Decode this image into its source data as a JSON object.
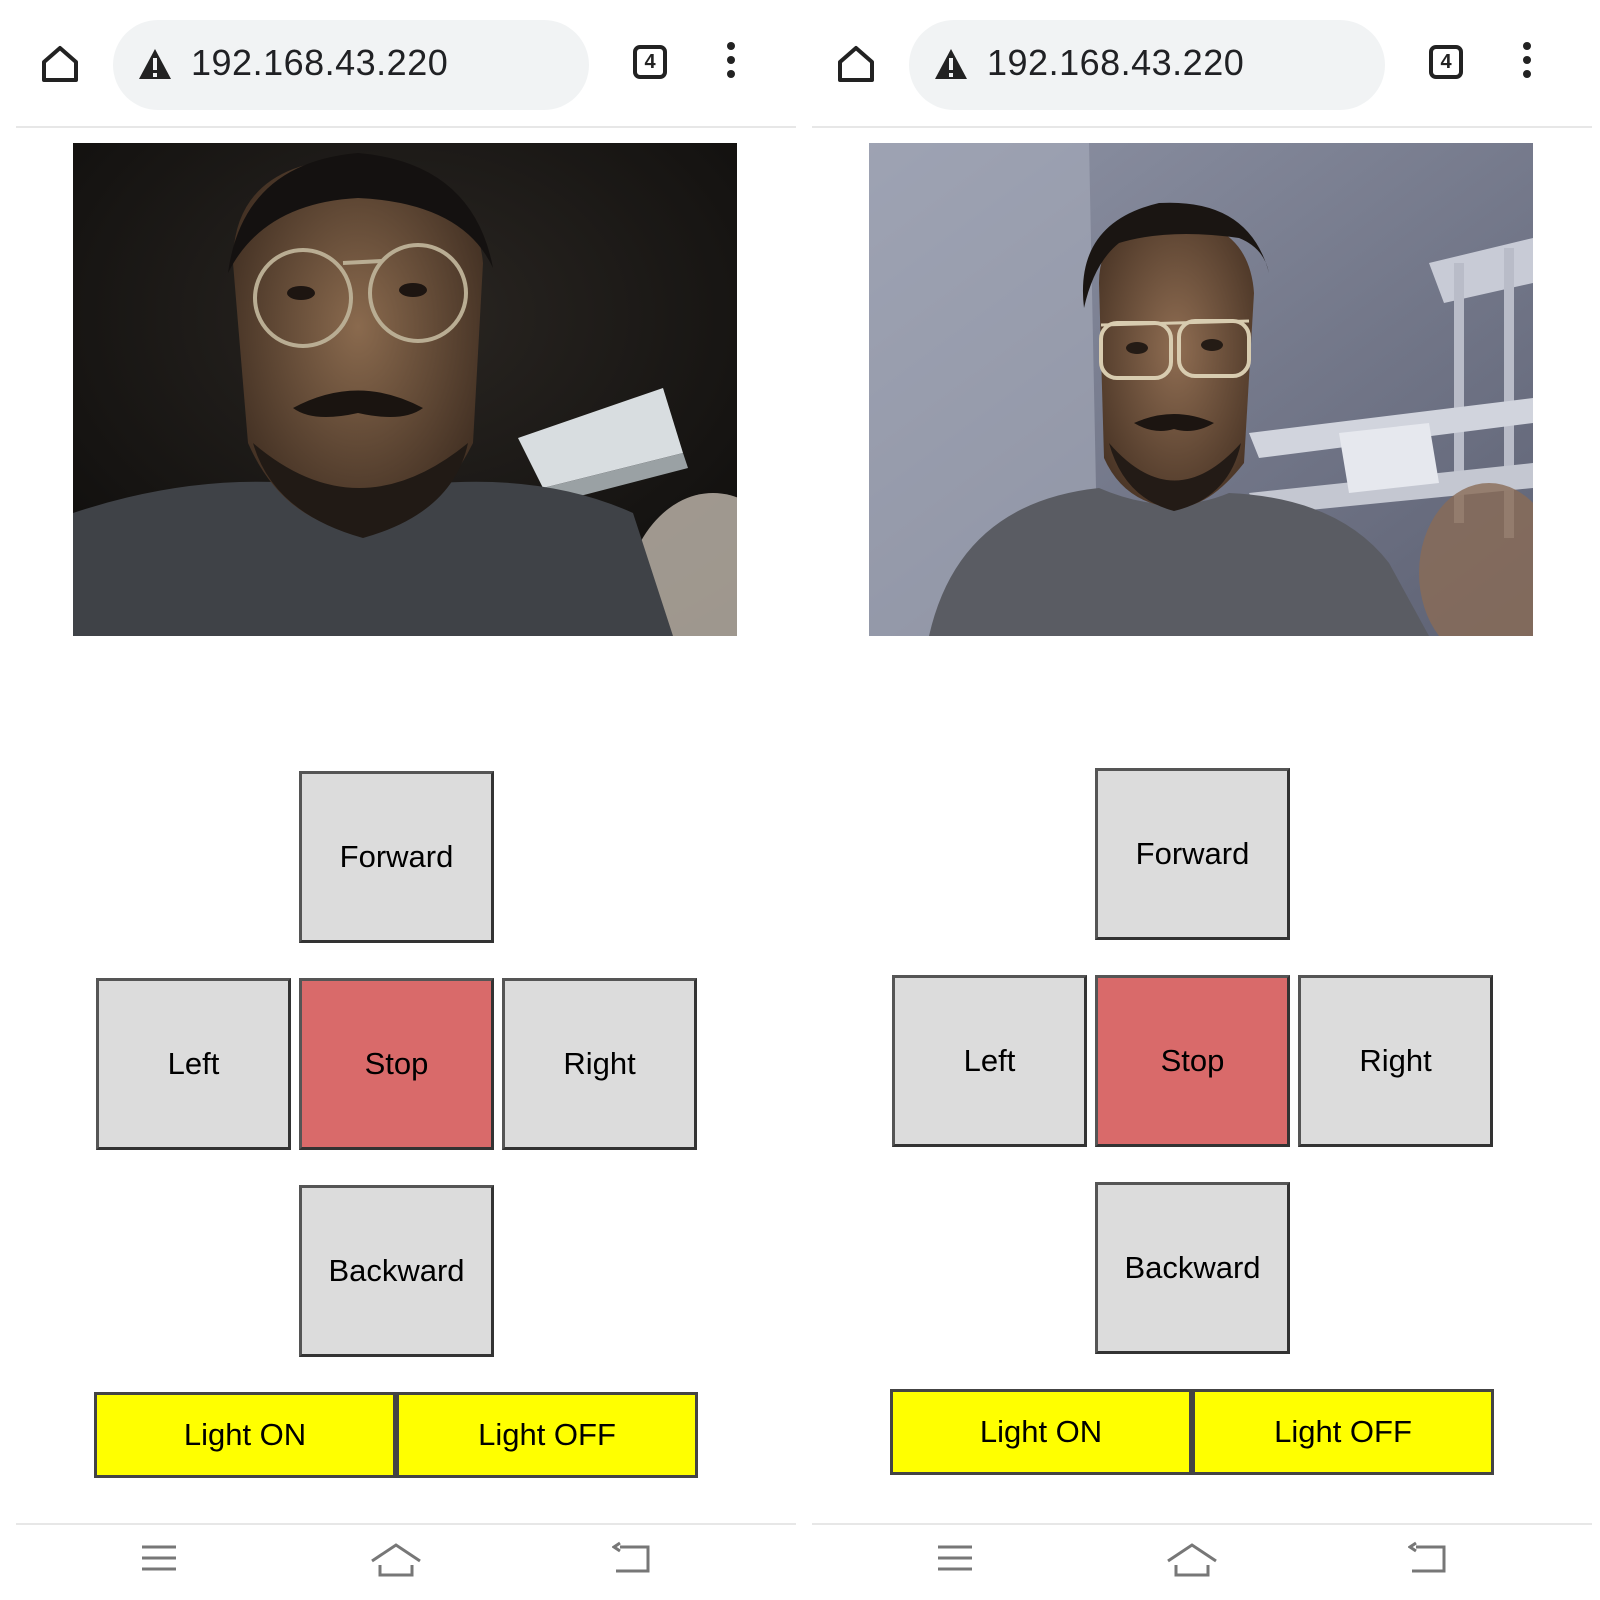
{
  "screens": [
    {
      "address_bar": {
        "url": "192.168.43.220",
        "tab_count": "4"
      },
      "controls": {
        "forward": "Forward",
        "left": "Left",
        "stop": "Stop",
        "right": "Right",
        "backward": "Backward",
        "light_on": "Light ON",
        "light_off": "Light OFF"
      }
    },
    {
      "address_bar": {
        "url": "192.168.43.220",
        "tab_count": "4"
      },
      "controls": {
        "forward": "Forward",
        "left": "Left",
        "stop": "Stop",
        "right": "Right",
        "backward": "Backward",
        "light_on": "Light ON",
        "light_off": "Light OFF"
      }
    }
  ],
  "colors": {
    "direction_button": "#dcdcdc",
    "stop_button": "#d96a6a",
    "light_button": "#ffff00"
  },
  "icons": [
    "home-icon",
    "warning-icon",
    "tab-switcher-icon",
    "overflow-menu-icon",
    "recent-apps-icon",
    "system-home-icon",
    "back-icon"
  ]
}
